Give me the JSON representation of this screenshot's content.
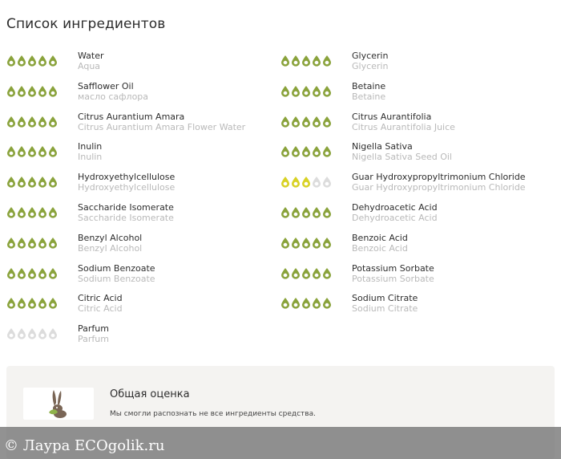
{
  "page_title": "Список ингредиентов",
  "colors": {
    "good": "#8aa33c",
    "medium": "#d8d226",
    "empty": "#dcdcdc"
  },
  "icon": "drop-rating-icon",
  "left_column": [
    {
      "name": "Water",
      "sub": "Aqua",
      "rating": 5,
      "level": "good"
    },
    {
      "name": "Safflower Oil",
      "sub": "масло сафлора",
      "rating": 5,
      "level": "good"
    },
    {
      "name": "Citrus Aurantium Amara",
      "sub": "Citrus Aurantium Amara Flower Water",
      "rating": 5,
      "level": "good"
    },
    {
      "name": "Inulin",
      "sub": "Inulin",
      "rating": 5,
      "level": "good"
    },
    {
      "name": "Hydroxyethylcellulose",
      "sub": "Hydroxyethylcellulose",
      "rating": 5,
      "level": "good"
    },
    {
      "name": "Saccharide Isomerate",
      "sub": "Saccharide Isomerate",
      "rating": 5,
      "level": "good"
    },
    {
      "name": "Benzyl Alcohol",
      "sub": "Benzyl Alcohol",
      "rating": 5,
      "level": "good"
    },
    {
      "name": "Sodium Benzoate",
      "sub": "Sodium Benzoate",
      "rating": 5,
      "level": "good"
    },
    {
      "name": "Citric Acid",
      "sub": "Citric Acid",
      "rating": 5,
      "level": "good"
    },
    {
      "name": "Parfum",
      "sub": "Parfum",
      "rating": 0,
      "level": "empty"
    }
  ],
  "right_column": [
    {
      "name": "Glycerin",
      "sub": "Glycerin",
      "rating": 5,
      "level": "good"
    },
    {
      "name": "Betaine",
      "sub": "Betaine",
      "rating": 5,
      "level": "good"
    },
    {
      "name": "Citrus Aurantifolia",
      "sub": "Citrus Aurantifolia Juice",
      "rating": 5,
      "level": "good"
    },
    {
      "name": "Nigella Sativa",
      "sub": "Nigella Sativa Seed Oil",
      "rating": 5,
      "level": "good"
    },
    {
      "name": "Guar Hydroxypropyltrimonium Chloride",
      "sub": "Guar Hydroxypropyltrimonium Chloride",
      "rating": 3,
      "level": "medium"
    },
    {
      "name": "Dehydroacetic Acid",
      "sub": "Dehydroacetic Acid",
      "rating": 5,
      "level": "good"
    },
    {
      "name": "Benzoic Acid",
      "sub": "Benzoic Acid",
      "rating": 5,
      "level": "good"
    },
    {
      "name": "Potassium Sorbate",
      "sub": "Potassium Sorbate",
      "rating": 5,
      "level": "good"
    },
    {
      "name": "Sodium Citrate",
      "sub": "Sodium Citrate",
      "rating": 5,
      "level": "good"
    }
  ],
  "summary": {
    "title": "Общая оценка",
    "text": "Мы смогли распознать не все ингредиенты средства.",
    "logo_icon": "rabbit-leaf-logo-icon"
  },
  "watermark": "© Лаура ECOgolik.ru"
}
